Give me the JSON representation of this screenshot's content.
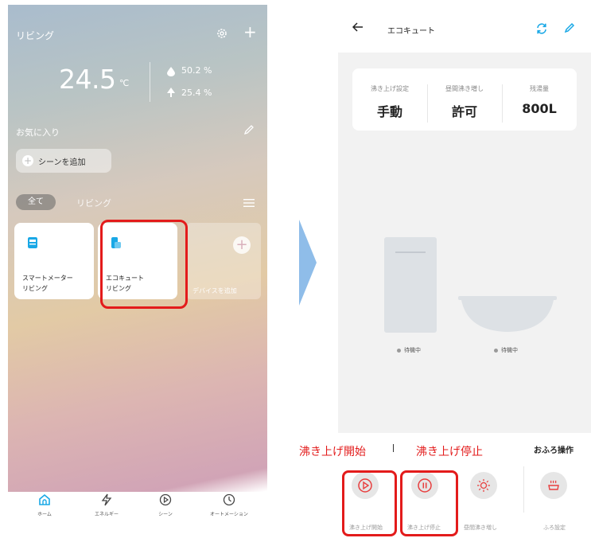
{
  "left": {
    "room_title": "リビング",
    "temperature": "24.5",
    "temp_unit": "℃",
    "humidity": "50.2 %",
    "other_value": "25.4 %",
    "favorites_label": "お気に入り",
    "add_scene_label": "シーンを追加",
    "tabs": [
      "全て",
      "リビング"
    ],
    "devices": [
      {
        "name": "スマートメーター",
        "room": "リビング"
      },
      {
        "name": "エコキュート",
        "room": "リビング"
      }
    ],
    "add_device_label": "デバイスを追加",
    "bottom_nav": [
      {
        "label": "ホーム",
        "icon": "home-icon"
      },
      {
        "label": "エネルギー",
        "icon": "lightning-icon"
      },
      {
        "label": "シーン",
        "icon": "play-circle-icon"
      },
      {
        "label": "オートメーション",
        "icon": "clock-icon"
      }
    ]
  },
  "right": {
    "title": "エコキュート",
    "info": [
      {
        "label": "沸き上げ設定",
        "value": "手動"
      },
      {
        "label": "昼間沸き増し",
        "value": "許可"
      },
      {
        "label": "残湯量",
        "value": "800L"
      }
    ],
    "tank_status": "待機中",
    "tub_status": "待機中",
    "bath_ops_title": "おふろ操作",
    "controls": [
      {
        "label": "沸き上げ開始",
        "icon": "play-circle-icon"
      },
      {
        "label": "沸き上げ停止",
        "icon": "pause-circle-icon"
      },
      {
        "label": "昼間沸き増し",
        "icon": "sun-icon"
      },
      {
        "label": "ふろ設定",
        "icon": "bath-icon"
      }
    ]
  },
  "annotations": {
    "label_start": "沸き上げ開始",
    "label_stop": "沸き上げ停止"
  },
  "colors": {
    "accent": "#19a8e6",
    "control_red": "#e83e3e",
    "highlight": "#e31b1b",
    "arrow": "#8fbde9"
  }
}
